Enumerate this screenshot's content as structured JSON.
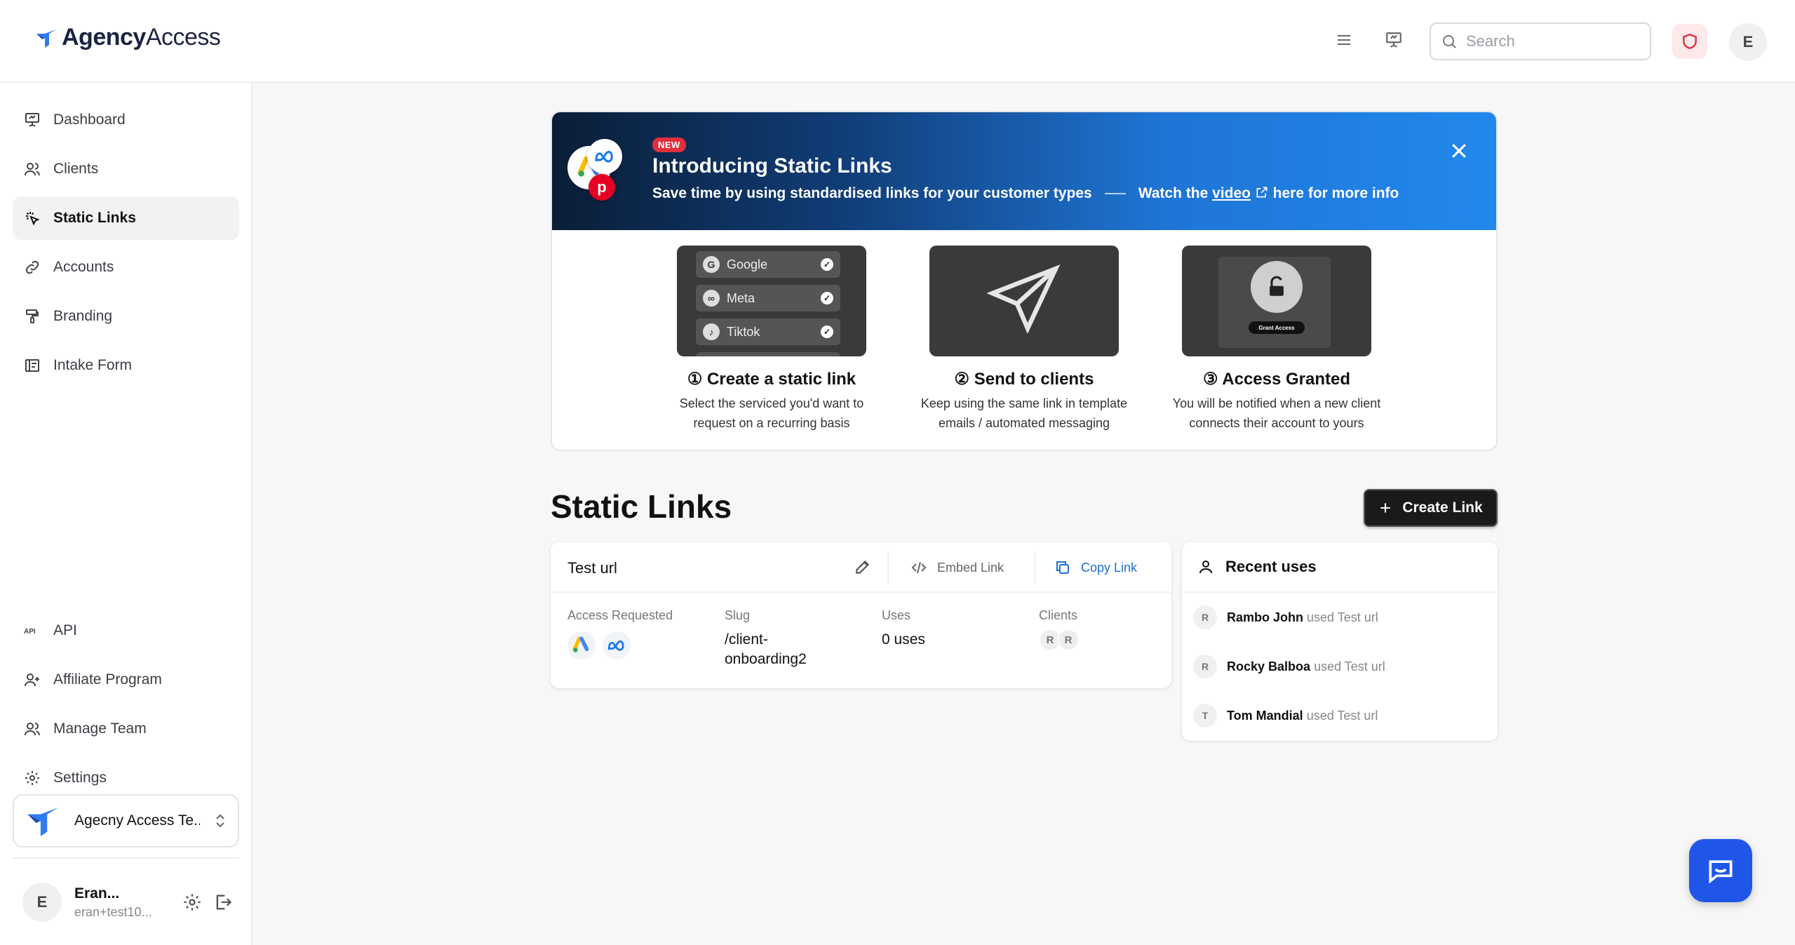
{
  "brand": {
    "name_part1": "Agency",
    "name_part2": "Access",
    "accent": "#2f7bf0"
  },
  "header": {
    "search_placeholder": "Search",
    "avatar_initial": "E"
  },
  "sidebar": {
    "items": [
      {
        "label": "Dashboard",
        "icon": "presentation-icon"
      },
      {
        "label": "Clients",
        "icon": "users-icon"
      },
      {
        "label": "Static Links",
        "icon": "sparkle-click-icon",
        "active": true
      },
      {
        "label": "Accounts",
        "icon": "link-icon"
      },
      {
        "label": "Branding",
        "icon": "paint-roller-icon"
      },
      {
        "label": "Intake Form",
        "icon": "form-icon"
      }
    ],
    "bottom_items": [
      {
        "label": "API",
        "icon": "api-icon"
      },
      {
        "label": "Affiliate Program",
        "icon": "user-plus-icon"
      },
      {
        "label": "Manage Team",
        "icon": "users-icon"
      },
      {
        "label": "Settings",
        "icon": "gear-icon"
      }
    ],
    "team_name": "Agecny Access Te...",
    "user": {
      "initial": "E",
      "name": "Eran...",
      "email": "eran+test10..."
    }
  },
  "banner": {
    "badge": "NEW",
    "title": "Introducing Static Links",
    "subtitle": "Save time by using standardised links for your customer types",
    "watch_prefix": "Watch the",
    "watch_link": "video",
    "watch_suffix": "here for more info",
    "steps": [
      {
        "title": "① Create a static link",
        "desc1": "Select the serviced you'd want to",
        "desc2": "request on a recurring basis",
        "options": [
          "Google",
          "Meta",
          "Tiktok"
        ]
      },
      {
        "title": "② Send to clients",
        "desc1": "Keep using the same link in template",
        "desc2": "emails / automated messaging"
      },
      {
        "title": "③ Access Granted",
        "desc1": "You will be notified when a new client",
        "desc2": "connects their account to yours",
        "button": "Grant Access"
      }
    ]
  },
  "main": {
    "title": "Static Links",
    "create_button": "Create Link",
    "link_card": {
      "name": "Test url",
      "embed_label": "Embed Link",
      "copy_label": "Copy Link",
      "columns": {
        "access_label": "Access Requested",
        "slug_label": "Slug",
        "slug_line1": "/client-",
        "slug_line2": "onboarding2",
        "uses_label": "Uses",
        "uses_value": "0 uses",
        "clients_label": "Clients",
        "client_initials": [
          "R",
          "R"
        ]
      }
    },
    "recent": {
      "title": "Recent uses",
      "rows": [
        {
          "initial": "R",
          "name": "Rambo John",
          "meta": "used Test url"
        },
        {
          "initial": "R",
          "name": "Rocky Balboa",
          "meta": "used Test url"
        },
        {
          "initial": "T",
          "name": "Tom Mandial",
          "meta": "used Test url"
        }
      ]
    }
  }
}
